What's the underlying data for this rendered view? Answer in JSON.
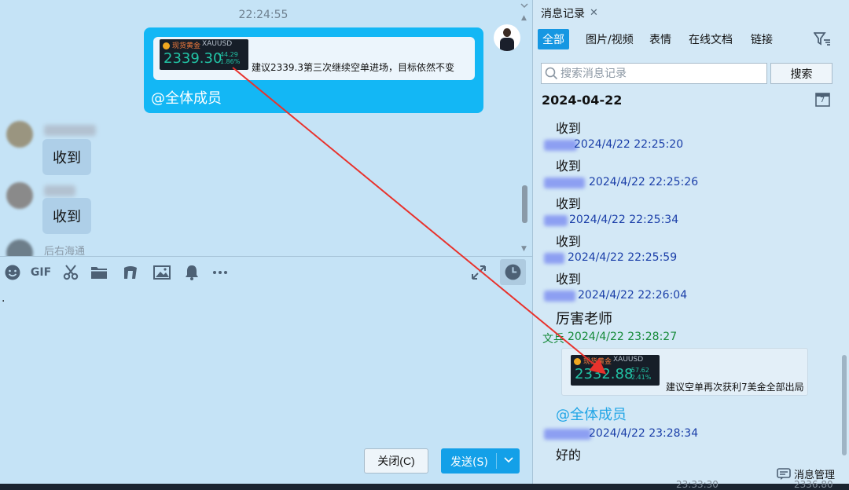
{
  "chat": {
    "timestamp": "22:24:55",
    "sent_message": {
      "quote_card": {
        "instrument_name": "现货黄金",
        "symbol": "XAUUSD",
        "price": "2339.30",
        "change": "-44.29",
        "change_pct": "-1.86%",
        "text": "建议2339.3第三次继续空单进场，目标依然不变"
      },
      "mention": "@全体成员"
    },
    "received": [
      {
        "text": "收到"
      },
      {
        "text": "收到"
      }
    ],
    "partial_text": "后右海通"
  },
  "toolbar": {
    "gif_label": "GIF"
  },
  "input": {
    "value": "."
  },
  "buttons": {
    "close": "关闭(C)",
    "send": "发送(S)"
  },
  "history": {
    "tab_title": "消息记录",
    "filters": [
      "全部",
      "图片/视频",
      "表情",
      "在线文档",
      "链接"
    ],
    "active_filter": "全部",
    "search_placeholder": "搜索消息记录",
    "search_button": "搜索",
    "date": "2024-04-22",
    "calendar_day": "7",
    "messages": [
      {
        "text": "收到",
        "time": "2024/4/22 22:25:20"
      },
      {
        "text": "收到",
        "time": "2024/4/22 22:25:26"
      },
      {
        "text": "收到",
        "time": "2024/4/22 22:25:34"
      },
      {
        "text": "收到",
        "time": "2024/4/22 22:25:59"
      },
      {
        "text": "收到",
        "time": "2024/4/22 22:26:04"
      },
      {
        "text": "厉害老师",
        "time": "2024/4/22 23:28:27",
        "sender": "文兵"
      },
      {
        "text": "好的",
        "time": "2024/4/22 23:28:34"
      }
    ],
    "quote_card": {
      "instrument_name": "现货黄金",
      "symbol": "XAUUSD",
      "price": "2332.88",
      "change": "-57.62",
      "change_pct": "-2.41%",
      "text": "建议空单再次获利7美金全部出局"
    },
    "mention": "@全体成员",
    "manage_label": "消息管理"
  },
  "bottom_strip": {
    "time": "23:33:30",
    "price": "2336.80"
  },
  "colors": {
    "chat_bg": "#c5e3f6",
    "sent_bubble": "#13b7f5",
    "send_button": "#13a0e8",
    "active_tab": "#1697e2",
    "time_link": "#1a3ea8",
    "sender_green": "#168a3a",
    "annotation_arrow": "#e8322c"
  }
}
